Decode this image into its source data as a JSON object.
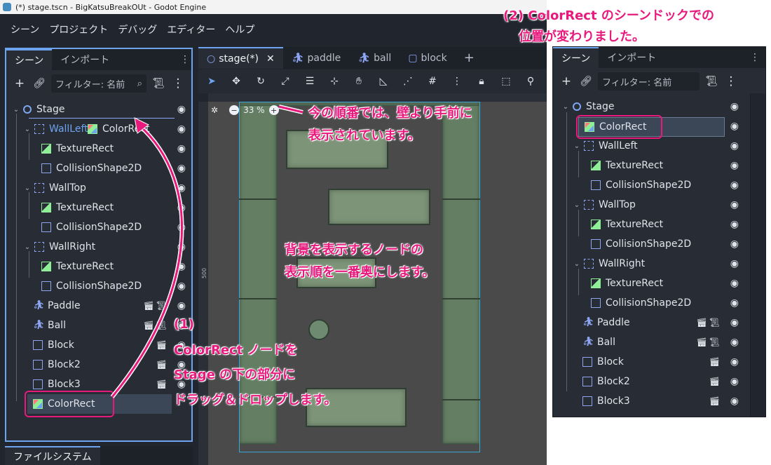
{
  "window": {
    "title": "(*) stage.tscn - BigKatsuBreakOUt - Godot Engine"
  },
  "menu": [
    "シーン",
    "プロジェクト",
    "デバッグ",
    "エディター",
    "ヘルプ"
  ],
  "scene_dock": {
    "tabs": [
      "シーン",
      "インポート"
    ],
    "filter_placeholder": "フィルター: 名前",
    "tree": [
      {
        "label": "Stage",
        "icon": "node2d"
      },
      {
        "label": "WallLeft",
        "icon": "box-dash"
      },
      {
        "label": "TextureRect",
        "icon": "texture"
      },
      {
        "label": "CollisionShape2D",
        "icon": "box"
      },
      {
        "label": "WallTop",
        "icon": "box-dash"
      },
      {
        "label": "TextureRect",
        "icon": "texture"
      },
      {
        "label": "CollisionShape2D",
        "icon": "box"
      },
      {
        "label": "WallRight",
        "icon": "box-dash"
      },
      {
        "label": "TextureRect",
        "icon": "texture"
      },
      {
        "label": "CollisionShape2D",
        "icon": "box"
      },
      {
        "label": "Paddle",
        "icon": "body"
      },
      {
        "label": "Ball",
        "icon": "body"
      },
      {
        "label": "Block",
        "icon": "box"
      },
      {
        "label": "Block2",
        "icon": "box"
      },
      {
        "label": "Block3",
        "icon": "box"
      },
      {
        "label": "ColorRect",
        "icon": "colorrect"
      }
    ],
    "drag_ghost": "ColorRect"
  },
  "filesystem_tab": "ファイルシステム",
  "editor": {
    "tabs": [
      "stage(*)",
      "paddle",
      "ball",
      "block"
    ],
    "zoom": "33 %",
    "ruler_mark": "500"
  },
  "panel2": {
    "tabs": [
      "シーン",
      "インポート"
    ],
    "filter_placeholder": "フィルター: 名前",
    "tree": [
      {
        "label": "Stage"
      },
      {
        "label": "ColorRect"
      },
      {
        "label": "WallLeft"
      },
      {
        "label": "TextureRect"
      },
      {
        "label": "CollisionShape2D"
      },
      {
        "label": "WallTop"
      },
      {
        "label": "TextureRect"
      },
      {
        "label": "CollisionShape2D"
      },
      {
        "label": "WallRight"
      },
      {
        "label": "TextureRect"
      },
      {
        "label": "CollisionShape2D"
      },
      {
        "label": "Paddle"
      },
      {
        "label": "Ball"
      },
      {
        "label": "Block"
      },
      {
        "label": "Block2"
      },
      {
        "label": "Block3"
      }
    ]
  },
  "annotations": {
    "top_right_1": "(2) ColorRect のシーンドックでの",
    "top_right_2": "位置が変わりました。",
    "current_order_1": "今の順番では、壁より手前に",
    "current_order_2": "表示されています。",
    "background_1": "背景を表示するノードの",
    "background_2": "表示順を一番奥にします。",
    "step1_1": "(1)",
    "step1_2": "ColorRect ノードを",
    "step1_3": "Stage の下の部分に",
    "step1_4": "ドラッグ＆ドロップします。"
  },
  "colors": {
    "annotation": "#e8197d",
    "editor_bg": "#21262e",
    "panel_bg": "#282d35",
    "accent": "#6ca4f0"
  }
}
